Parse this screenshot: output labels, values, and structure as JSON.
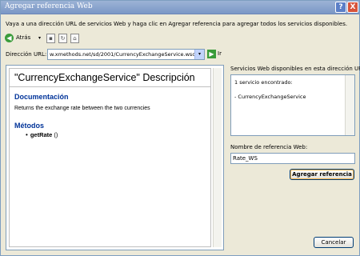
{
  "window": {
    "title": "Agregar referencia Web",
    "help_label": "?",
    "close_label": "X"
  },
  "instruction": "Vaya a una dirección URL de servicios Web y haga clic en Agregar referencia para agregar todos los servicios disponibles.",
  "toolbar": {
    "back_label": "Atrás",
    "icons": [
      "back-icon",
      "dropdown-arrow-icon",
      "stop-icon",
      "refresh-icon",
      "home-icon"
    ]
  },
  "address": {
    "label": "Dirección URL:",
    "value": "w.xmethods.net/sd/2001/CurrencyExchangeService.wsdl",
    "go_label": "Ir"
  },
  "browser": {
    "title": "\"CurrencyExchangeService\" Descripción",
    "doc_heading": "Documentación",
    "doc_text": "Returns the exchange rate between the two currencies",
    "methods_heading": "Métodos",
    "methods": [
      {
        "name": "getRate",
        "params": "()"
      }
    ]
  },
  "services": {
    "label": "Servicios Web disponibles en esta dirección URL:",
    "found_text": "1 servicio encontrado:",
    "items": [
      "- CurrencyExchangeService"
    ]
  },
  "reference": {
    "label": "Nombre de referencia Web:",
    "value": "Rate_WS",
    "add_button": "Agregar referencia"
  },
  "cancel_button": "Cancelar",
  "colors": {
    "titlebar": "#7b97c6",
    "heading": "#003399",
    "dialog_bg": "#ece9d8",
    "go_green": "#3a9c3a"
  }
}
